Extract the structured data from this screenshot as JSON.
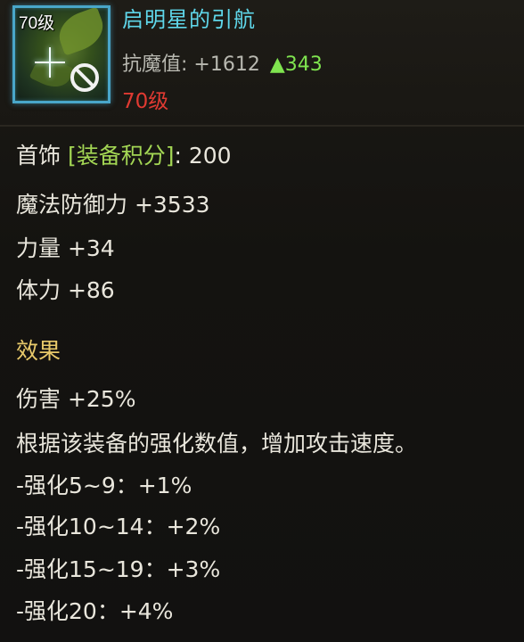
{
  "item": {
    "icon_level_badge": "70级",
    "icon_name": "star-sparkle-icon",
    "restriction_icon": "forbidden-icon",
    "name": "启明星的引航",
    "primary_stat_label": "抗魔值:",
    "primary_stat_value": "+1612",
    "primary_stat_increase": "▲343",
    "required_level": "70级"
  },
  "details": {
    "slot_label": "首饰",
    "score_label": "[装备积分]",
    "score_sep": ":",
    "score_value": "200",
    "stats": [
      "魔法防御力 +3533",
      "力量 +34",
      "体力 +86"
    ]
  },
  "effects": {
    "title": "效果",
    "lines": [
      "伤害 +25%",
      "根据该装备的强化数值，增加攻击速度。",
      "-强化5~9：+1%",
      "-强化10~14：+2%",
      "-强化15~19：+3%",
      "-强化20：+4%"
    ]
  },
  "colors": {
    "title": "#5fd7ea",
    "increase": "#7fe44f",
    "required_level": "#e03a32",
    "bracket_label": "#a3d654",
    "effect_title": "#e8c96a"
  }
}
